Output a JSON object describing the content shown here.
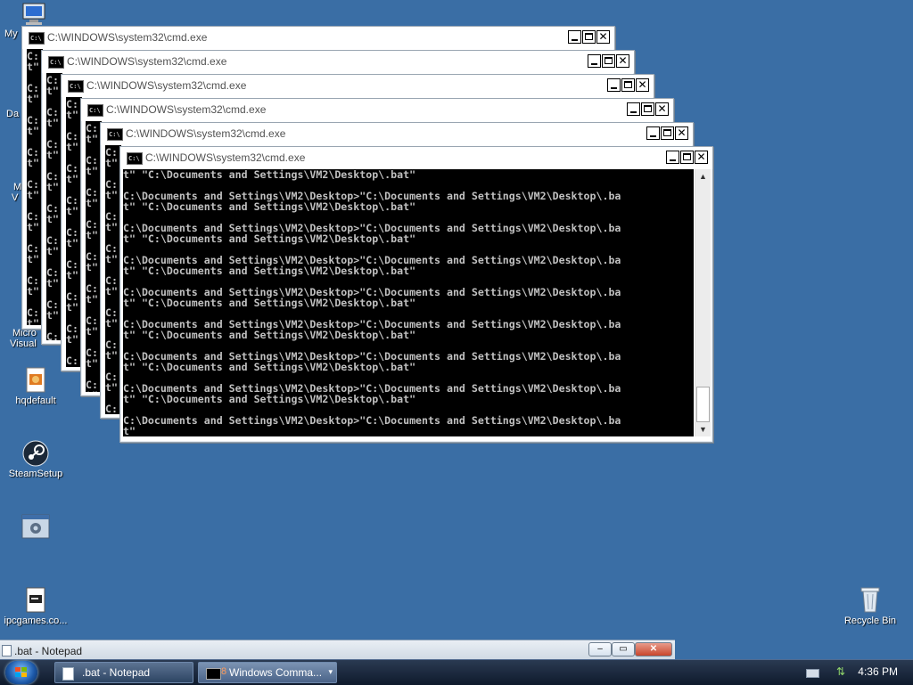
{
  "desktop": {
    "icons": [
      {
        "name": "my-computer",
        "label": "My"
      },
      {
        "name": "partial-da",
        "label": "Da"
      },
      {
        "name": "partial-m",
        "label": "M"
      },
      {
        "name": "partial-v",
        "label": "V"
      },
      {
        "name": "microsoft-visual",
        "label1": "Micro",
        "label2": "Visual"
      },
      {
        "name": "hqdefault",
        "label": "hqdefault"
      },
      {
        "name": "steamsetup",
        "label": "SteamSetup"
      },
      {
        "name": "unnamed-window-icon",
        "label": ""
      },
      {
        "name": "ipcgames",
        "label": "ipcgames.co..."
      },
      {
        "name": "recycle-bin",
        "label": "Recycle Bin"
      }
    ]
  },
  "cmd_windows": {
    "title": "C:\\WINDOWS\\system32\\cmd.exe",
    "back_console_lines": [
      "C:",
      "t\"",
      "",
      "C:",
      "t\"",
      "",
      "C:",
      "t\"",
      "",
      "C:",
      "t\"",
      "",
      "C:",
      "t\"",
      "",
      "C:",
      "t\"",
      "",
      "C:",
      "t\"",
      "",
      "C:",
      "t\"",
      "",
      "C:",
      "t\""
    ],
    "front_console_lines": [
      "t\" \"C:\\Documents and Settings\\VM2\\Desktop\\.bat\"",
      "",
      "C:\\Documents and Settings\\VM2\\Desktop>\"C:\\Documents and Settings\\VM2\\Desktop\\.ba",
      "t\" \"C:\\Documents and Settings\\VM2\\Desktop\\.bat\"",
      "",
      "C:\\Documents and Settings\\VM2\\Desktop>\"C:\\Documents and Settings\\VM2\\Desktop\\.ba",
      "t\" \"C:\\Documents and Settings\\VM2\\Desktop\\.bat\"",
      "",
      "C:\\Documents and Settings\\VM2\\Desktop>\"C:\\Documents and Settings\\VM2\\Desktop\\.ba",
      "t\" \"C:\\Documents and Settings\\VM2\\Desktop\\.bat\"",
      "",
      "C:\\Documents and Settings\\VM2\\Desktop>\"C:\\Documents and Settings\\VM2\\Desktop\\.ba",
      "t\" \"C:\\Documents and Settings\\VM2\\Desktop\\.bat\"",
      "",
      "C:\\Documents and Settings\\VM2\\Desktop>\"C:\\Documents and Settings\\VM2\\Desktop\\.ba",
      "t\" \"C:\\Documents and Settings\\VM2\\Desktop\\.bat\"",
      "",
      "C:\\Documents and Settings\\VM2\\Desktop>\"C:\\Documents and Settings\\VM2\\Desktop\\.ba",
      "t\" \"C:\\Documents and Settings\\VM2\\Desktop\\.bat\"",
      "",
      "C:\\Documents and Settings\\VM2\\Desktop>\"C:\\Documents and Settings\\VM2\\Desktop\\.ba",
      "t\" \"C:\\Documents and Settings\\VM2\\Desktop\\.bat\"",
      "",
      "C:\\Documents and Settings\\VM2\\Desktop>\"C:\\Documents and Settings\\VM2\\Desktop\\.ba",
      "t\""
    ],
    "app_icon_text": "C:\\",
    "close_glyph": "✕"
  },
  "notepad_bar": {
    "title": ".bat - Notepad"
  },
  "taskbar": {
    "buttons": [
      {
        "label": ".bat - Notepad"
      },
      {
        "label": "Windows Comma...",
        "count": "8"
      }
    ],
    "clock": "4:36 PM"
  },
  "colors": {
    "desktop": "#3a6ea5",
    "console_bg": "#000000",
    "console_fg": "#c0c0c0"
  }
}
